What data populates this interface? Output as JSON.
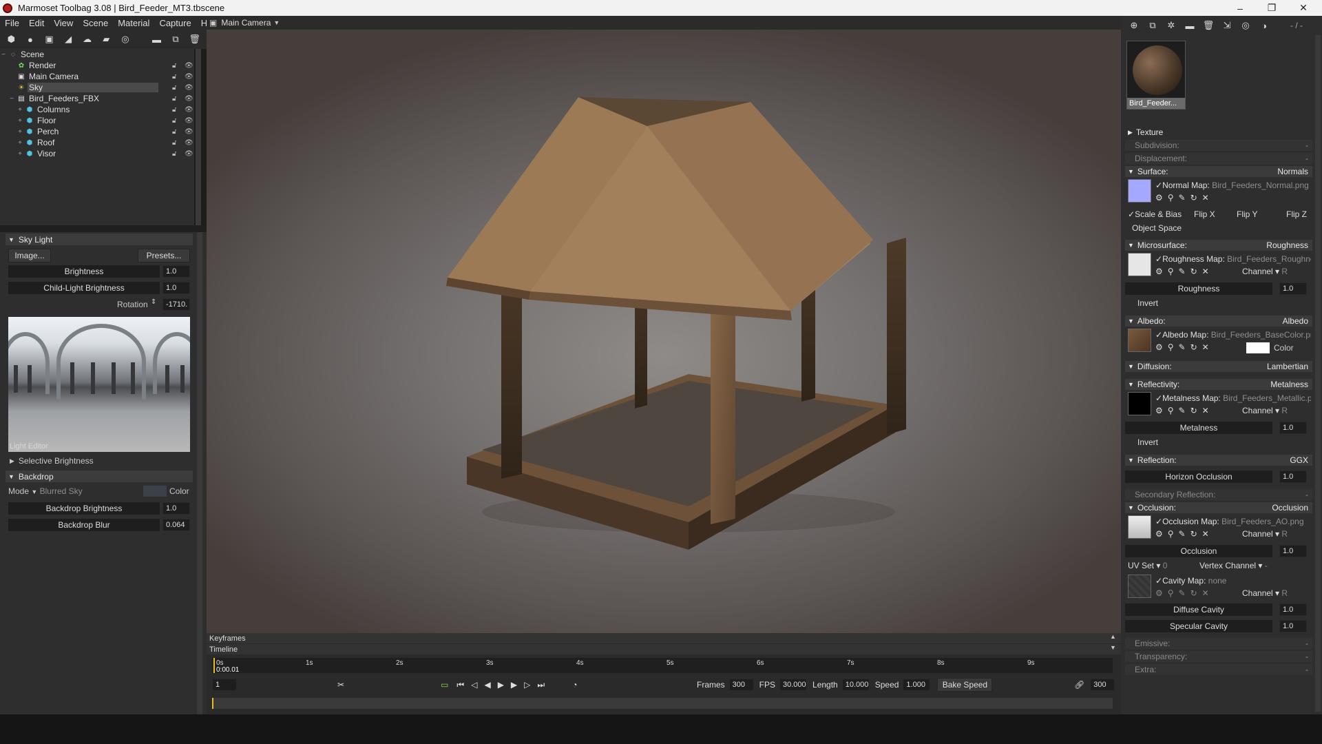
{
  "window": {
    "title": "Marmoset Toolbag 3.08  |  Bird_Feeder_MT3.tbscene",
    "minimize": "–",
    "restore": "❐",
    "close": "✕"
  },
  "menu": [
    "File",
    "Edit",
    "View",
    "Scene",
    "Material",
    "Capture",
    "Help"
  ],
  "outliner": {
    "items": [
      {
        "label": "Scene",
        "icon": "globe-icon",
        "level": 0
      },
      {
        "label": "Render",
        "icon": "gear-icon",
        "level": 1
      },
      {
        "label": "Main Camera",
        "icon": "camera-icon",
        "level": 1
      },
      {
        "label": "Sky",
        "icon": "sky-icon",
        "level": 1,
        "selected": true
      },
      {
        "label": "Bird_Feeders_FBX",
        "icon": "file-icon",
        "level": 1
      },
      {
        "label": "Columns",
        "icon": "mesh-icon",
        "level": 2
      },
      {
        "label": "Floor",
        "icon": "mesh-icon",
        "level": 2
      },
      {
        "label": "Perch",
        "icon": "mesh-icon",
        "level": 2
      },
      {
        "label": "Roof",
        "icon": "mesh-icon",
        "level": 2
      },
      {
        "label": "Visor",
        "icon": "mesh-icon",
        "level": 2
      }
    ]
  },
  "skylight": {
    "header": "Sky Light",
    "image_btn": "Image...",
    "presets_btn": "Presets...",
    "brightness_label": "Brightness",
    "brightness_value": "1.0",
    "child_label": "Child-Light Brightness",
    "child_value": "1.0",
    "rotation_label": "Rotation",
    "rotation_value": "-1710.",
    "light_editor": "Light Editor",
    "selective": "Selective Brightness"
  },
  "backdrop": {
    "header": "Backdrop",
    "mode_label": "Mode",
    "mode_value": "Blurred Sky",
    "color_label": "Color",
    "brightness_label": "Backdrop Brightness",
    "brightness_value": "1.0",
    "blur_label": "Backdrop Blur",
    "blur_value": "0.064"
  },
  "viewport": {
    "camera": "Main Camera"
  },
  "timeline": {
    "keyframes": "Keyframes",
    "timeline": "Timeline",
    "current": "0:00.01",
    "ticks": [
      "0s",
      "1s",
      "2s",
      "3s",
      "4s",
      "5s",
      "6s",
      "7s",
      "8s",
      "9s"
    ],
    "frame_field": "1",
    "frames_label": "Frames",
    "frames_value": "300",
    "fps_label": "FPS",
    "fps_value": "30.000",
    "length_label": "Length",
    "length_value": "10.000",
    "speed_label": "Speed",
    "speed_value": "1.000",
    "bake_speed": "Bake Speed",
    "end_value": "300"
  },
  "material": {
    "thumb_label": "Bird_Feeder...",
    "top_right": "- / -",
    "texture": "Texture",
    "subdivision": "Subdivision:",
    "displacement": "Displacement:",
    "dash": "-",
    "surface": {
      "label": "Surface:",
      "value": "Normals",
      "map_label": "Normal Map:",
      "map_file": "Bird_Feeders_Normal.png",
      "scale_bias": "Scale & Bias",
      "flipx": "Flip X",
      "flipy": "Flip Y",
      "flipz": "Flip Z",
      "object_space": "Object Space"
    },
    "micro": {
      "label": "Microsurface:",
      "value": "Roughness",
      "map_label": "Roughness Map:",
      "map_file": "Bird_Feeders_Roughness",
      "channel": "Channel",
      "ch": "R",
      "slider_label": "Roughness",
      "slider_value": "1.0",
      "invert": "Invert"
    },
    "albedo": {
      "label": "Albedo:",
      "value": "Albedo",
      "map_label": "Albedo Map:",
      "map_file": "Bird_Feeders_BaseColor.png",
      "color": "Color"
    },
    "diffusion": {
      "label": "Diffusion:",
      "value": "Lambertian"
    },
    "reflectivity": {
      "label": "Reflectivity:",
      "value": "Metalness",
      "map_label": "Metalness Map:",
      "map_file": "Bird_Feeders_Metallic.png",
      "channel": "Channel",
      "ch": "R",
      "slider_label": "Metalness",
      "slider_value": "1.0",
      "invert": "Invert"
    },
    "reflection": {
      "label": "Reflection:",
      "value": "GGX",
      "slider_label": "Horizon Occlusion",
      "slider_value": "1.0"
    },
    "secondary": "Secondary Reflection:",
    "occlusion": {
      "label": "Occlusion:",
      "value": "Occlusion",
      "map_label": "Occlusion Map:",
      "map_file": "Bird_Feeders_AO.png",
      "channel": "Channel",
      "ch": "R",
      "slider_label": "Occlusion",
      "slider_value": "1.0",
      "uvset": "UV Set",
      "uv_value": "0",
      "vertex": "Vertex Channel",
      "vertex_value": "-",
      "cavity_label": "Cavity Map:",
      "cavity_file": "none",
      "diffuse_cavity": "Diffuse Cavity",
      "diffuse_value": "1.0",
      "specular_cavity": "Specular Cavity",
      "specular_value": "1.0"
    },
    "emissive": "Emissive:",
    "transparency": "Transparency:",
    "extra": "Extra:"
  }
}
